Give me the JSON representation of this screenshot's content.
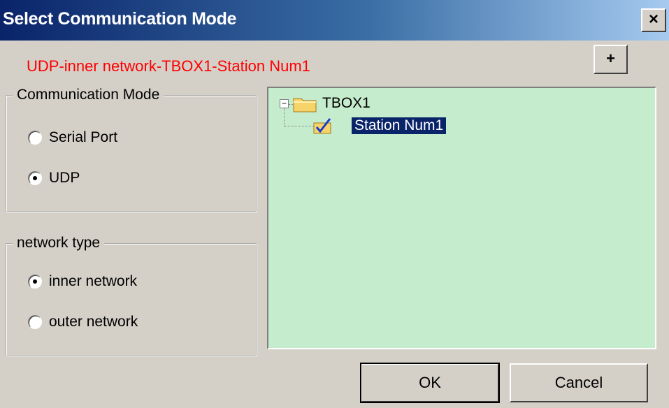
{
  "window": {
    "title": "Select Communication Mode",
    "close_label": "×"
  },
  "subtitle": "UDP-inner network-TBOX1-Station Num1",
  "add_button_label": "+",
  "communication_mode": {
    "legend": "Communication Mode",
    "options": [
      {
        "label": "Serial Port",
        "checked": false
      },
      {
        "label": "UDP",
        "checked": true
      }
    ]
  },
  "network_type": {
    "legend": "network type",
    "options": [
      {
        "label": "inner network",
        "checked": true
      },
      {
        "label": "outer network",
        "checked": false
      }
    ]
  },
  "tree": {
    "root": {
      "label": "TBOX1",
      "expander": "−",
      "icon": "folder-icon"
    },
    "child": {
      "label": "Station Num1",
      "icon": "station-check-icon",
      "selected": true
    }
  },
  "buttons": {
    "ok_label": "OK",
    "cancel_label": "Cancel"
  },
  "colors": {
    "subtitle": "#ff0000",
    "tree_background": "#c6ecce",
    "selection": "#0a246a"
  }
}
